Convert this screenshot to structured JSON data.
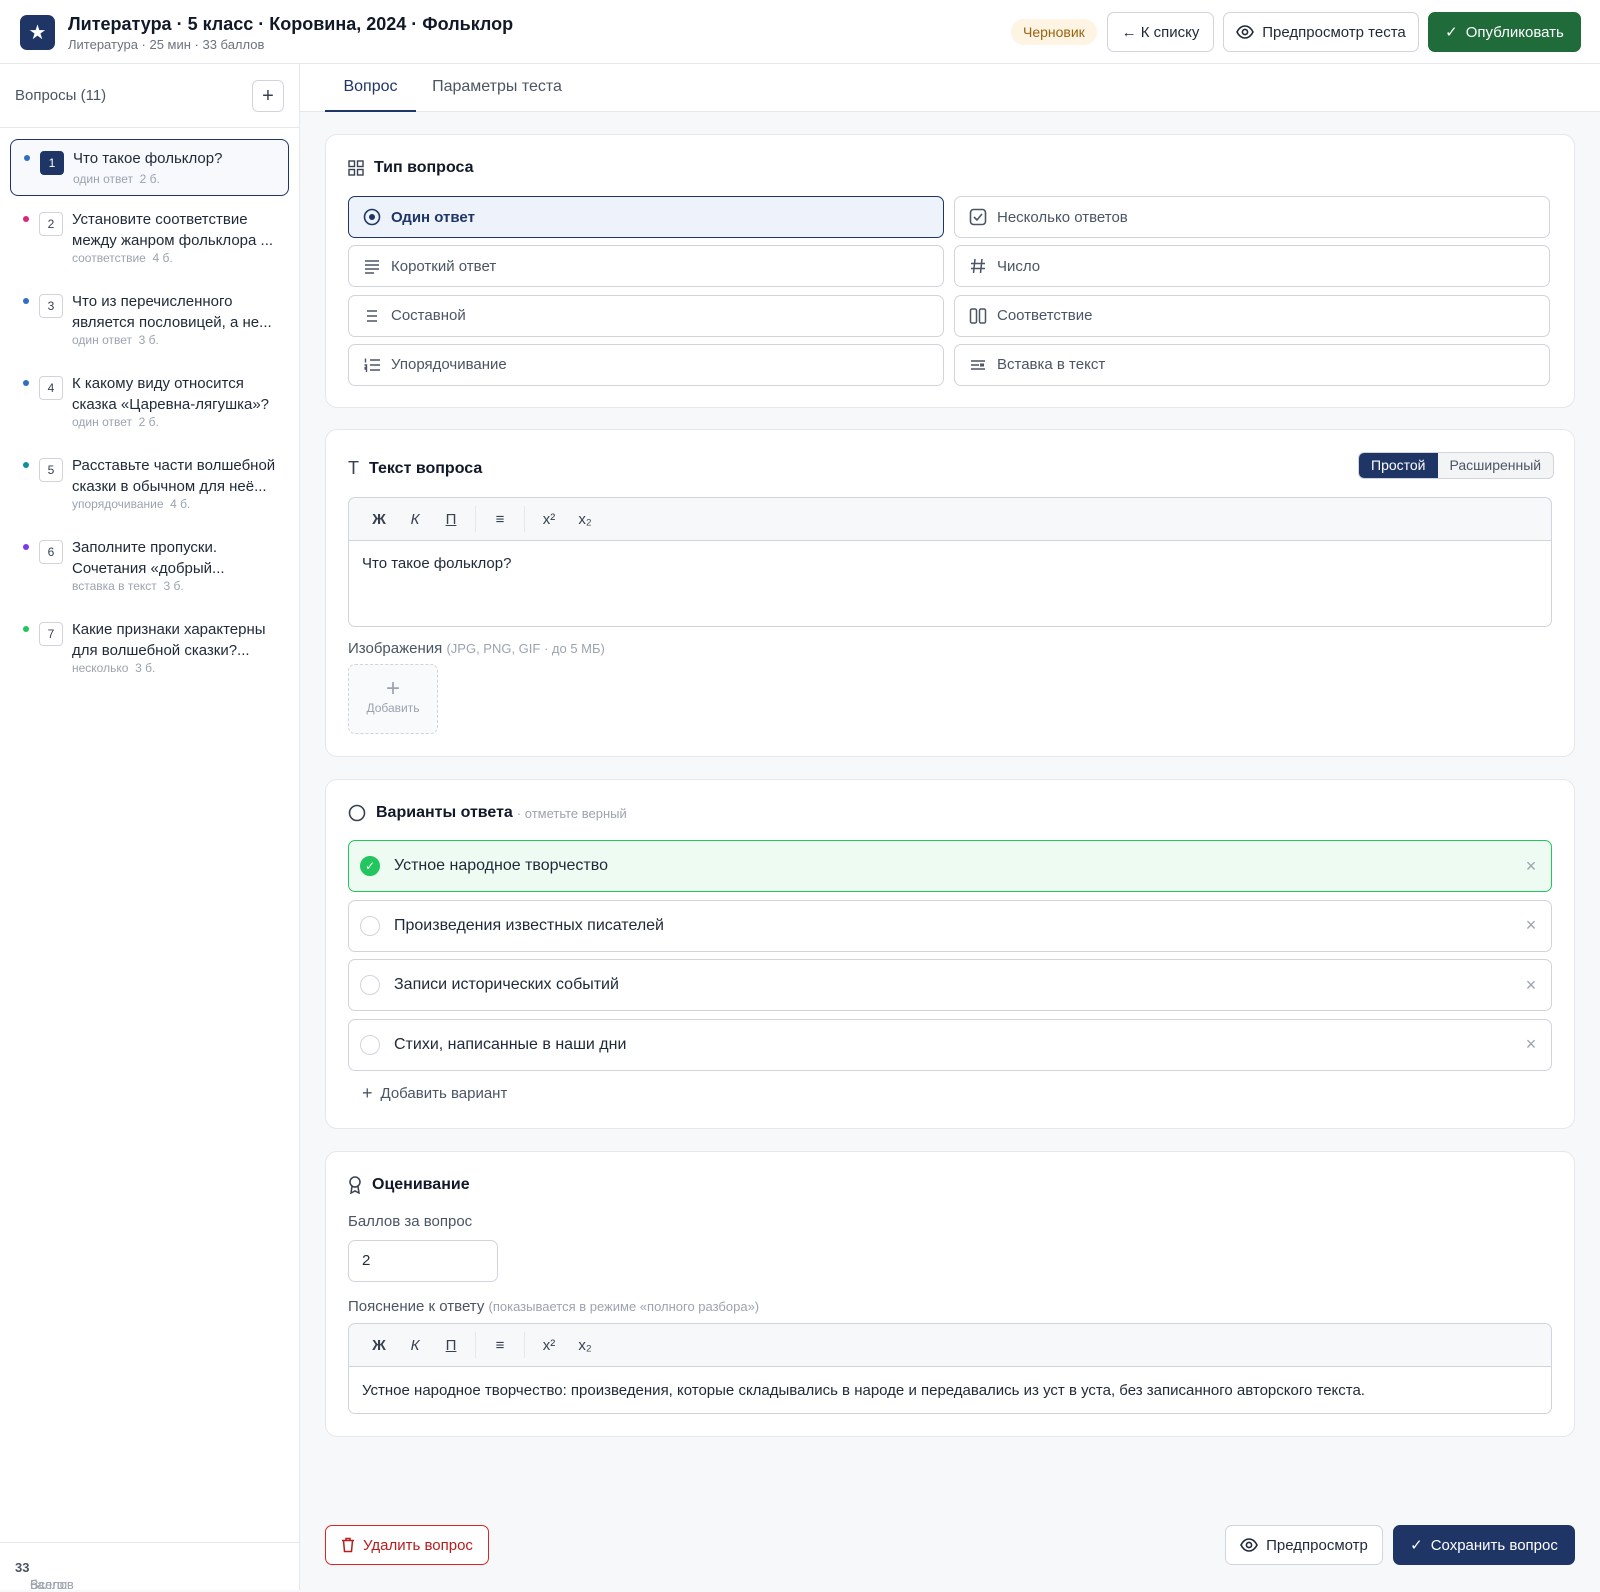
{
  "header": {
    "title": "Литература · 5 класс · Коровина, 2024 · Фольклор",
    "subtitle": "Литература · 25 мин · 33 баллов",
    "status": "Черновик",
    "back_label": "← К списку",
    "preview_label": "Предпросмотр теста",
    "publish_label": "Опубликовать"
  },
  "sidebar": {
    "title": "Вопросы (11)",
    "items": [
      {
        "num": "1",
        "text": "Что такое фольклор?",
        "type": "один ответ",
        "points": "2 б.",
        "color": "#2f6fbf"
      },
      {
        "num": "2",
        "text": "Установите соответствие между жанром фольклора ...",
        "type": "соответствие",
        "points": "4 б.",
        "color": "#db2777"
      },
      {
        "num": "3",
        "text": "Что из перечисленного является пословицей, а не...",
        "type": "один ответ",
        "points": "3 б.",
        "color": "#2f6fbf"
      },
      {
        "num": "4",
        "text": "К какому виду относится сказка «Царевна-лягушка»?",
        "type": "один ответ",
        "points": "2 б.",
        "color": "#2f6fbf"
      },
      {
        "num": "5",
        "text": "Расставьте части волшебной сказки в обычном для неё...",
        "type": "упорядочивание",
        "points": "4 б.",
        "color": "#0e8fa0"
      },
      {
        "num": "6",
        "text": "Заполните пропуски. Сочетания «добрый...",
        "type": "вставка в текст",
        "points": "3 б.",
        "color": "#7c3aed"
      },
      {
        "num": "7",
        "text": "Какие признаки характерны для волшебной сказки?...",
        "type": "несколько",
        "points": "3 б.",
        "color": "#22c55e"
      }
    ],
    "footer_prefix": "Всего:",
    "footer_total": "33",
    "footer_suffix": "баллов"
  },
  "tabs": [
    "Вопрос",
    "Параметры теста"
  ],
  "question_type": {
    "title": "Тип вопроса",
    "options": [
      {
        "label": "Один ответ",
        "icon": "radio-icon",
        "selected": true
      },
      {
        "label": "Несколько ответов",
        "icon": "checkbox-icon",
        "selected": false
      },
      {
        "label": "Короткий ответ",
        "icon": "lines-icon",
        "selected": false
      },
      {
        "label": "Число",
        "icon": "hash-icon",
        "selected": false
      },
      {
        "label": "Составной",
        "icon": "list-icon",
        "selected": false
      },
      {
        "label": "Соответствие",
        "icon": "columns-icon",
        "selected": false
      },
      {
        "label": "Упорядочивание",
        "icon": "ordered-list-icon",
        "selected": false
      },
      {
        "label": "Вставка в текст",
        "icon": "text-insert-icon",
        "selected": false
      }
    ]
  },
  "question_text": {
    "title": "Текст вопроса",
    "mode_simple": "Простой",
    "mode_advanced": "Расширенный",
    "toolbar": {
      "bold": "Ж",
      "italic": "К",
      "underline": "П",
      "list": "≡",
      "sup": "x²",
      "sub": "x₂"
    },
    "value": "Что такое фольклор?",
    "images_label": "Изображения",
    "images_hint": "(JPG, PNG, GIF · до 5 МБ)",
    "add_image_label": "Добавить"
  },
  "answers": {
    "title": "Варианты ответа",
    "hint": "· отметьте верный",
    "options": [
      {
        "text": "Устное народное творчество",
        "correct": true
      },
      {
        "text": "Произведения известных писателей",
        "correct": false
      },
      {
        "text": "Записи исторических событий",
        "correct": false
      },
      {
        "text": "Стихи, написанные в наши дни",
        "correct": false
      }
    ],
    "add_label": "Добавить вариант"
  },
  "grading": {
    "title": "Оценивание",
    "points_label": "Баллов за вопрос",
    "points_value": "2",
    "explanation_label": "Пояснение к ответу",
    "explanation_hint": "(показывается в режиме «полного разбора»)",
    "explanation_value": "Устное народное творчество: произведения, которые складывались в народе и передавались из уст в уста, без записанного авторского текста."
  },
  "footer": {
    "delete_label": "Удалить вопрос",
    "preview_label": "Предпросмотр",
    "save_label": "Сохранить вопрос"
  },
  "colors": {
    "primary": "#1e3566",
    "publish": "#1f6b3a",
    "correct": "#22c55e",
    "danger": "#b91c1c"
  }
}
